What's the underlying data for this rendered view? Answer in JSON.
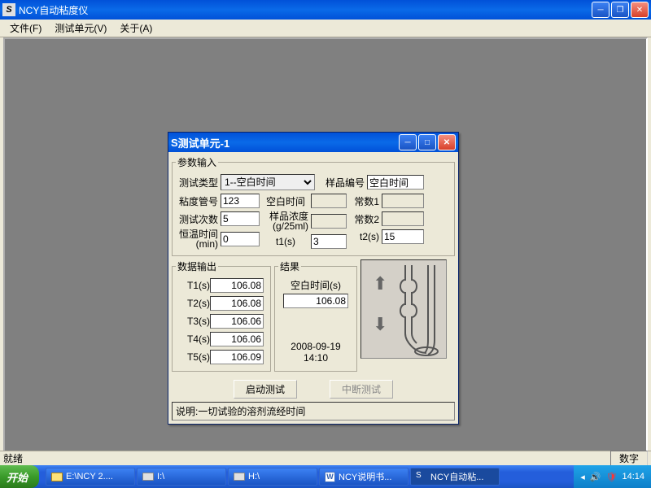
{
  "main": {
    "app_icon_letter": "S",
    "title": "NCY自动粘度仪"
  },
  "menu": {
    "file": "文件(F)",
    "unit": "测试单元(V)",
    "about": "关于(A)"
  },
  "status": {
    "left": "就绪",
    "right": "数字"
  },
  "dialog": {
    "icon_letter": "S",
    "title": "测试单元-1",
    "group_params": "参数输入",
    "test_type_label": "测试类型",
    "test_type_value": "1--空白时间",
    "sample_no_label": "样品编号",
    "sample_no_value": "空白时间",
    "tube_no_label": "粘度管号",
    "tube_no_value": "123",
    "blank_time_label": "空白时间",
    "blank_time_value": "",
    "const1_label": "常数1",
    "const1_value": "",
    "test_count_label": "测试次数",
    "test_count_value": "5",
    "density_label_1": "样品浓度",
    "density_label_2": "(g/25ml)",
    "density_value": "",
    "const2_label": "常数2",
    "const2_value": "",
    "temp_time_label_1": "恒温时间",
    "temp_time_label_2": "(min)",
    "temp_time_value": "0",
    "t1s_label": "t1(s)",
    "t1s_value": "3",
    "t2s_label": "t2(s)",
    "t2s_value": "15",
    "group_data_out": "数据输出",
    "T1_label": "T1(s)",
    "T1_value": "106.08",
    "T2_label": "T2(s)",
    "T2_value": "106.08",
    "T3_label": "T3(s)",
    "T3_value": "106.06",
    "T4_label": "T4(s)",
    "T4_value": "106.06",
    "T5_label": "T5(s)",
    "T5_value": "106.09",
    "group_result": "结果",
    "result_label": "空白时间(s)",
    "result_value": "106.08",
    "result_date": "2008-09-19",
    "result_time": "14:10",
    "btn_start": "启动测试",
    "btn_stop": "中断测试",
    "explain": "说明:一切试验的溶剂流经时间"
  },
  "taskbar": {
    "start": "开始",
    "items": [
      {
        "label": "E:\\NCY 2....",
        "icon": "folder"
      },
      {
        "label": "I:\\",
        "icon": "drive"
      },
      {
        "label": "H:\\",
        "icon": "drive"
      },
      {
        "label": "NCY说明书...",
        "icon": "word",
        "letter": "W"
      },
      {
        "label": "NCY自动粘...",
        "icon": "app",
        "letter": "S",
        "active": true
      }
    ],
    "clock": "14:14"
  }
}
